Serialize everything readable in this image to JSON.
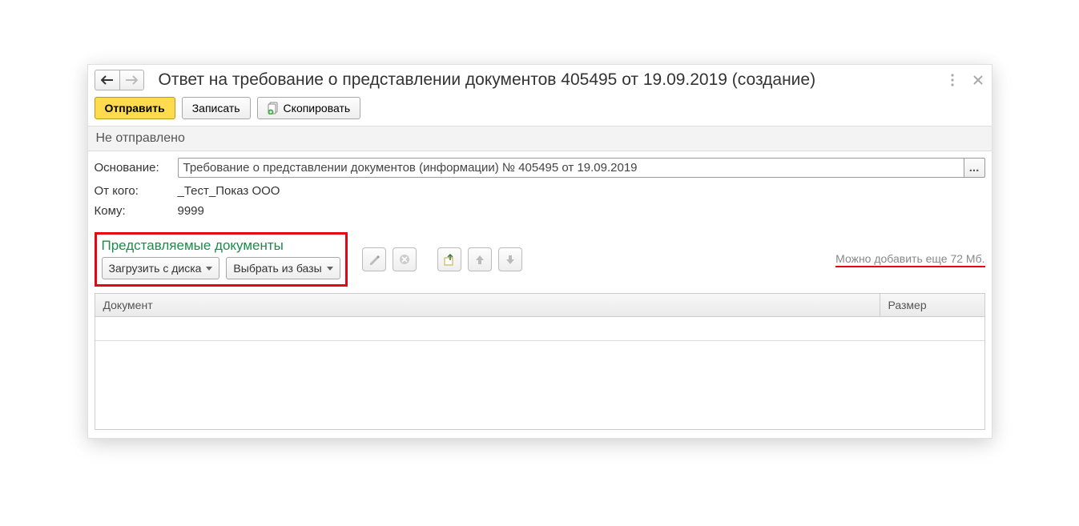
{
  "header": {
    "title": "Ответ на требование о представлении документов 405495 от 19.09.2019 (создание)"
  },
  "toolbar": {
    "send": "Отправить",
    "save": "Записать",
    "copy": "Скопировать"
  },
  "status": "Не отправлено",
  "fields": {
    "basis_label": "Основание:",
    "basis_value": "Требование о представлении документов (информации) № 405495 от 19.09.2019",
    "from_label": "От кого:",
    "from_value": "_Тест_Показ ООО",
    "to_label": "Кому:",
    "to_value": "9999"
  },
  "section": {
    "title": "Представляемые документы",
    "load_from_disk": "Загрузить с диска",
    "select_from_base": "Выбрать из базы",
    "hint": "Можно добавить еще 72 Мб."
  },
  "table": {
    "col_document": "Документ",
    "col_size": "Размер"
  }
}
